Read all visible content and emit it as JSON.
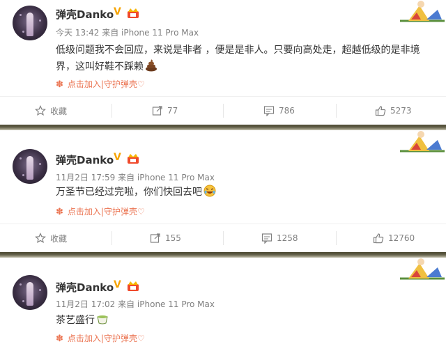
{
  "posts": [
    {
      "username": "弹壳Danko",
      "meta": "今天 13:42 来自 iPhone 11 Pro Max",
      "text": "低级问题我不会回应，来说是非者 ，便是是非人。只要向高处走，超越低级的是非境界，这叫好鞋不踩赖",
      "emoji": "poop-emoji",
      "fan_link": "点击加入|守护弹壳♡",
      "actions": {
        "favorite": "收藏",
        "repost": "77",
        "comment": "786",
        "like": "5273"
      }
    },
    {
      "username": "弹壳Danko",
      "meta": "11月2日 17:59 来自 iPhone 11 Pro Max",
      "text": "万圣节已经过完啦，你们快回去吧",
      "emoji": "laugh-cry-emoji",
      "fan_link": "点击加入|守护弹壳♡",
      "actions": {
        "favorite": "收藏",
        "repost": "155",
        "comment": "1258",
        "like": "12760"
      }
    },
    {
      "username": "弹壳Danko",
      "meta": "11月2日 17:02 来自 iPhone 11 Pro Max",
      "text": "茶艺盛行",
      "emoji": "tea-emoji",
      "fan_link": "点击加入|守护弹壳♡",
      "actions": null
    }
  ],
  "colors": {
    "accent_orange": "#eb7350",
    "verified_gold": "#f6a300",
    "text_gray": "#808080"
  }
}
